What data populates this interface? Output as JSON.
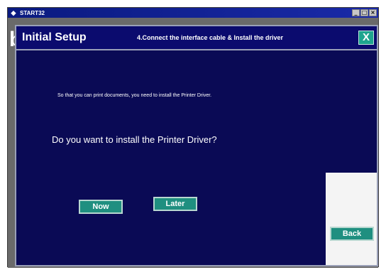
{
  "app": {
    "title": "START32",
    "icon": "app-icon",
    "bg_letter": "b",
    "controls": {
      "minimize": "_",
      "maximize": "□",
      "close": "×"
    }
  },
  "setup": {
    "title": "Initial Setup",
    "step_title": "4.Connect the interface cable & Install the driver",
    "close_label": "X",
    "info_text": "So that you can print documents, you need to install the Printer Driver.",
    "question": "Do you want to install the Printer Driver?",
    "buttons": {
      "now": "Now",
      "later": "Later",
      "back": "Back"
    }
  },
  "colors": {
    "dialog_background": "#0a0a55",
    "button_teal": "#1f8f80",
    "title_bar": "#0a1a80"
  }
}
